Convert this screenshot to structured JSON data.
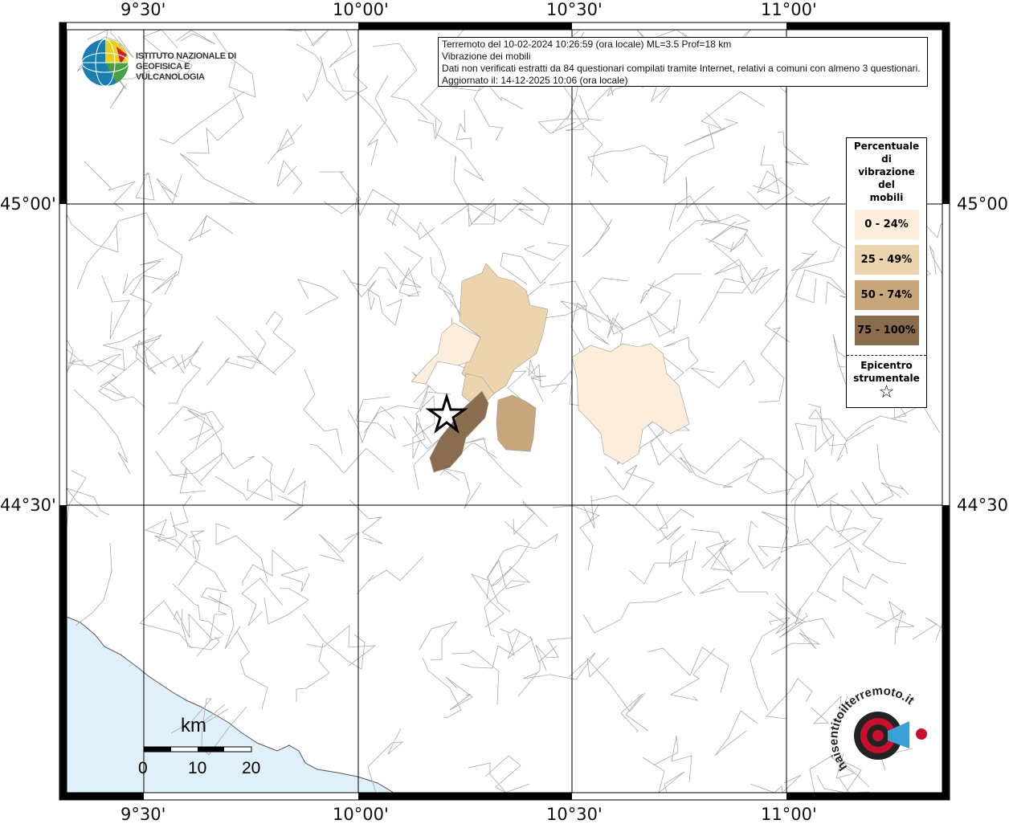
{
  "map": {
    "longitude_ticks": [
      "9°30'",
      "10°00'",
      "10°30'",
      "11°00'"
    ],
    "latitude_ticks": [
      "45°00'",
      "44°30'"
    ],
    "colors": {
      "sea": "#dff0fb",
      "land": "#ffffff",
      "boundaries": "#9a9a9a",
      "grid": "#000000"
    }
  },
  "info_box": {
    "line1": "Terremoto del 10-02-2024 10:26:59 (ora locale) ML=3.5 Prof=18 km",
    "line2": "Vibrazione dei mobili",
    "line3": "Dati non verificati estratti da 84 questionari compilati tramite Internet, relativi a comuni con almeno 3 questionari.",
    "line4": "Aggiornato il: 14-12-2025 10:06 (ora locale)"
  },
  "legend": {
    "title_lines": [
      "Percentuale",
      "di",
      "vibrazione",
      "del",
      "mobili"
    ],
    "classes": [
      {
        "label": "0 - 24%",
        "color": "#fdeedb"
      },
      {
        "label": "25 - 49%",
        "color": "#ecd5ae"
      },
      {
        "label": "50 - 74%",
        "color": "#c8a67c"
      },
      {
        "label": "75 - 100%",
        "color": "#8a6d4e"
      }
    ],
    "epicenter_lines": [
      "Epicentro",
      "strumentale"
    ],
    "epicenter_icon": "star-icon"
  },
  "scale_bar": {
    "unit": "km",
    "labels": [
      "0",
      "10",
      "20"
    ]
  },
  "logos": {
    "ingv": "ISTITUTO NAZIONALE DI GEOFISICA E VULCANOLOGIA",
    "haisentito": "www.haisentitoilterremoto.it"
  }
}
